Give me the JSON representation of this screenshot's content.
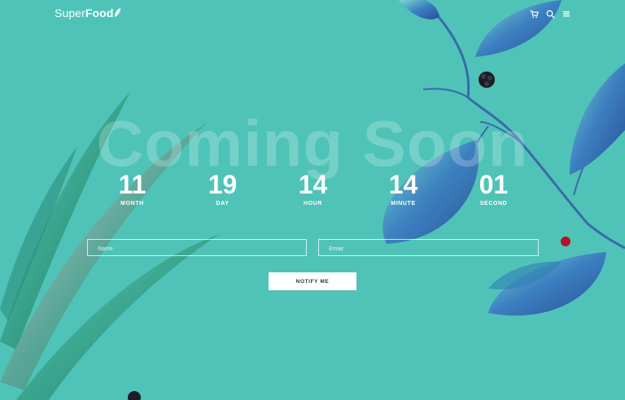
{
  "brand": {
    "logo_regular": "Super",
    "logo_bold": "Food"
  },
  "header": {
    "icons": [
      "cart-icon",
      "search-icon",
      "menu-icon"
    ],
    "cart_count": "0"
  },
  "hero": {
    "title": "Coming Soon"
  },
  "countdown": [
    {
      "value": "11",
      "label": "MONTH"
    },
    {
      "value": "19",
      "label": "DAY"
    },
    {
      "value": "14",
      "label": "HOUR"
    },
    {
      "value": "14",
      "label": "MINUTE"
    },
    {
      "value": "01",
      "label": "SECOND"
    }
  ],
  "form": {
    "name_placeholder": "Name",
    "email_placeholder": "Email",
    "submit_label": "NOTIFY ME"
  },
  "colors": {
    "background": "#4fc3b8",
    "text": "#ffffff",
    "leaf_blue": "#3a6fb0",
    "leaf_green": "#2b8a74",
    "berry_red": "#b3122a"
  }
}
